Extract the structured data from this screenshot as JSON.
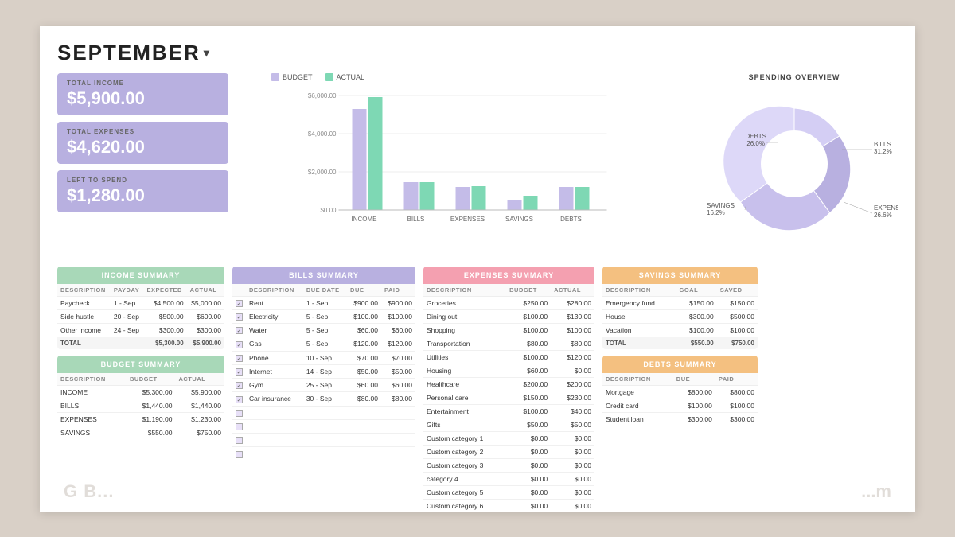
{
  "header": {
    "month": "SEPTEMBER",
    "dropdown_symbol": "▾"
  },
  "cards": {
    "income_label": "TOTAL INCOME",
    "income_value": "$5,900.00",
    "expenses_label": "TOTAL EXPENSES",
    "expenses_value": "$4,620.00",
    "left_label": "LEFT TO SPEND",
    "left_value": "$1,280.00"
  },
  "chart": {
    "legend_budget": "BUDGET",
    "legend_actual": "ACTUAL",
    "bars": [
      {
        "label": "INCOME",
        "budget": 5300,
        "actual": 5900
      },
      {
        "label": "BILLS",
        "budget": 1440,
        "actual": 1440
      },
      {
        "label": "EXPENSES",
        "budget": 1190,
        "actual": 1230
      },
      {
        "label": "SAVINGS",
        "budget": 550,
        "actual": 750
      },
      {
        "label": "DEBTS",
        "budget": 1200,
        "actual": 1200
      }
    ],
    "y_max": 6000
  },
  "donut": {
    "title": "SPENDING OVERVIEW",
    "segments": [
      {
        "label": "DEBTS",
        "pct": "26.0%",
        "value": 26.0,
        "color": "#c4bce8"
      },
      {
        "label": "BILLS",
        "pct": "31.2%",
        "value": 31.2,
        "color": "#b8b0e0"
      },
      {
        "label": "EXPENSES",
        "pct": "26.6%",
        "value": 26.6,
        "color": "#d4cef4"
      },
      {
        "label": "SAVINGS",
        "pct": "16.2%",
        "value": 16.2,
        "color": "#ddd8f8"
      }
    ]
  },
  "income_summary": {
    "header": "INCOME SUMMARY",
    "columns": [
      "DESCRIPTION",
      "PAYDAY",
      "EXPECTED",
      "ACTUAL"
    ],
    "rows": [
      {
        "desc": "Paycheck",
        "payday": "1 - Sep",
        "expected": "$4,500.00",
        "actual": "$5,000.00"
      },
      {
        "desc": "Side hustle",
        "payday": "20 - Sep",
        "expected": "$500.00",
        "actual": "$600.00"
      },
      {
        "desc": "Other income",
        "payday": "24 - Sep",
        "expected": "$300.00",
        "actual": "$300.00"
      }
    ],
    "total_label": "TOTAL",
    "total_expected": "$5,300.00",
    "total_actual": "$5,900.00"
  },
  "budget_summary": {
    "header": "BUDGET SUMMARY",
    "columns": [
      "DESCRIPTION",
      "BUDGET",
      "ACTUAL"
    ],
    "rows": [
      {
        "desc": "INCOME",
        "budget": "$5,300.00",
        "actual": "$5,900.00"
      },
      {
        "desc": "BILLS",
        "budget": "$1,440.00",
        "actual": "$1,440.00"
      },
      {
        "desc": "EXPENSES",
        "budget": "$1,190.00",
        "actual": "$1,230.00"
      },
      {
        "desc": "SAVINGS",
        "budget": "$550.00",
        "actual": "$750.00"
      }
    ]
  },
  "bills_summary": {
    "header": "BILLS SUMMARY",
    "columns": [
      "DESCRIPTION",
      "DUE DATE",
      "DUE",
      "PAID"
    ],
    "rows": [
      {
        "checked": true,
        "desc": "Rent",
        "due_date": "1 - Sep",
        "due": "$900.00",
        "paid": "$900.00"
      },
      {
        "checked": true,
        "desc": "Electricity",
        "due_date": "5 - Sep",
        "due": "$100.00",
        "paid": "$100.00"
      },
      {
        "checked": true,
        "desc": "Water",
        "due_date": "5 - Sep",
        "due": "$60.00",
        "paid": "$60.00"
      },
      {
        "checked": true,
        "desc": "Gas",
        "due_date": "5 - Sep",
        "due": "$120.00",
        "paid": "$120.00"
      },
      {
        "checked": true,
        "desc": "Phone",
        "due_date": "10 - Sep",
        "due": "$70.00",
        "paid": "$70.00"
      },
      {
        "checked": true,
        "desc": "Internet",
        "due_date": "14 - Sep",
        "due": "$50.00",
        "paid": "$50.00"
      },
      {
        "checked": true,
        "desc": "Gym",
        "due_date": "25 - Sep",
        "due": "$60.00",
        "paid": "$60.00"
      },
      {
        "checked": true,
        "desc": "Car insurance",
        "due_date": "30 - Sep",
        "due": "$80.00",
        "paid": "$80.00"
      },
      {
        "checked": false,
        "desc": "",
        "due_date": "",
        "due": "",
        "paid": ""
      },
      {
        "checked": false,
        "desc": "",
        "due_date": "",
        "due": "",
        "paid": ""
      },
      {
        "checked": false,
        "desc": "",
        "due_date": "",
        "due": "",
        "paid": ""
      },
      {
        "checked": false,
        "desc": "",
        "due_date": "",
        "due": "",
        "paid": ""
      }
    ]
  },
  "expenses_summary": {
    "header": "EXPENSES SUMMARY",
    "columns": [
      "DESCRIPTION",
      "BUDGET",
      "ACTUAL"
    ],
    "rows": [
      {
        "desc": "Groceries",
        "budget": "$250.00",
        "actual": "$280.00"
      },
      {
        "desc": "Dining out",
        "budget": "$100.00",
        "actual": "$130.00"
      },
      {
        "desc": "Shopping",
        "budget": "$100.00",
        "actual": "$100.00"
      },
      {
        "desc": "Transportation",
        "budget": "$80.00",
        "actual": "$80.00"
      },
      {
        "desc": "Utilities",
        "budget": "$100.00",
        "actual": "$120.00"
      },
      {
        "desc": "Housing",
        "budget": "$60.00",
        "actual": "$0.00"
      },
      {
        "desc": "Healthcare",
        "budget": "$200.00",
        "actual": "$200.00"
      },
      {
        "desc": "Personal care",
        "budget": "$150.00",
        "actual": "$230.00"
      },
      {
        "desc": "Entertainment",
        "budget": "$100.00",
        "actual": "$40.00"
      },
      {
        "desc": "Gifts",
        "budget": "$50.00",
        "actual": "$50.00"
      },
      {
        "desc": "Custom category 1",
        "budget": "$0.00",
        "actual": "$0.00"
      },
      {
        "desc": "Custom category 2",
        "budget": "$0.00",
        "actual": "$0.00"
      },
      {
        "desc": "Custom category 3",
        "budget": "$0.00",
        "actual": "$0.00"
      },
      {
        "desc": "category 4",
        "budget": "$0.00",
        "actual": "$0.00"
      },
      {
        "desc": "Custom category 5",
        "budget": "$0.00",
        "actual": "$0.00"
      },
      {
        "desc": "Custom category 6",
        "budget": "$0.00",
        "actual": "$0.00"
      }
    ]
  },
  "savings_summary": {
    "header": "SAVINGS SUMMARY",
    "columns": [
      "DESCRIPTION",
      "GOAL",
      "SAVED"
    ],
    "rows": [
      {
        "desc": "Emergency fund",
        "goal": "$150.00",
        "saved": "$150.00"
      },
      {
        "desc": "House",
        "goal": "$300.00",
        "saved": "$500.00"
      },
      {
        "desc": "Vacation",
        "goal": "$100.00",
        "saved": "$100.00"
      }
    ],
    "total_label": "TOTAL",
    "total_goal": "$550.00",
    "total_saved": "$750.00"
  },
  "debts_summary": {
    "header": "DEBTS SUMMARY",
    "columns": [
      "DESCRIPTION",
      "DUE",
      "PAID"
    ],
    "rows": [
      {
        "desc": "Mortgage",
        "due": "$800.00",
        "paid": "$800.00"
      },
      {
        "desc": "Credit card",
        "due": "$100.00",
        "paid": "$100.00"
      },
      {
        "desc": "Student loan",
        "due": "$300.00",
        "paid": "$300.00"
      }
    ]
  }
}
